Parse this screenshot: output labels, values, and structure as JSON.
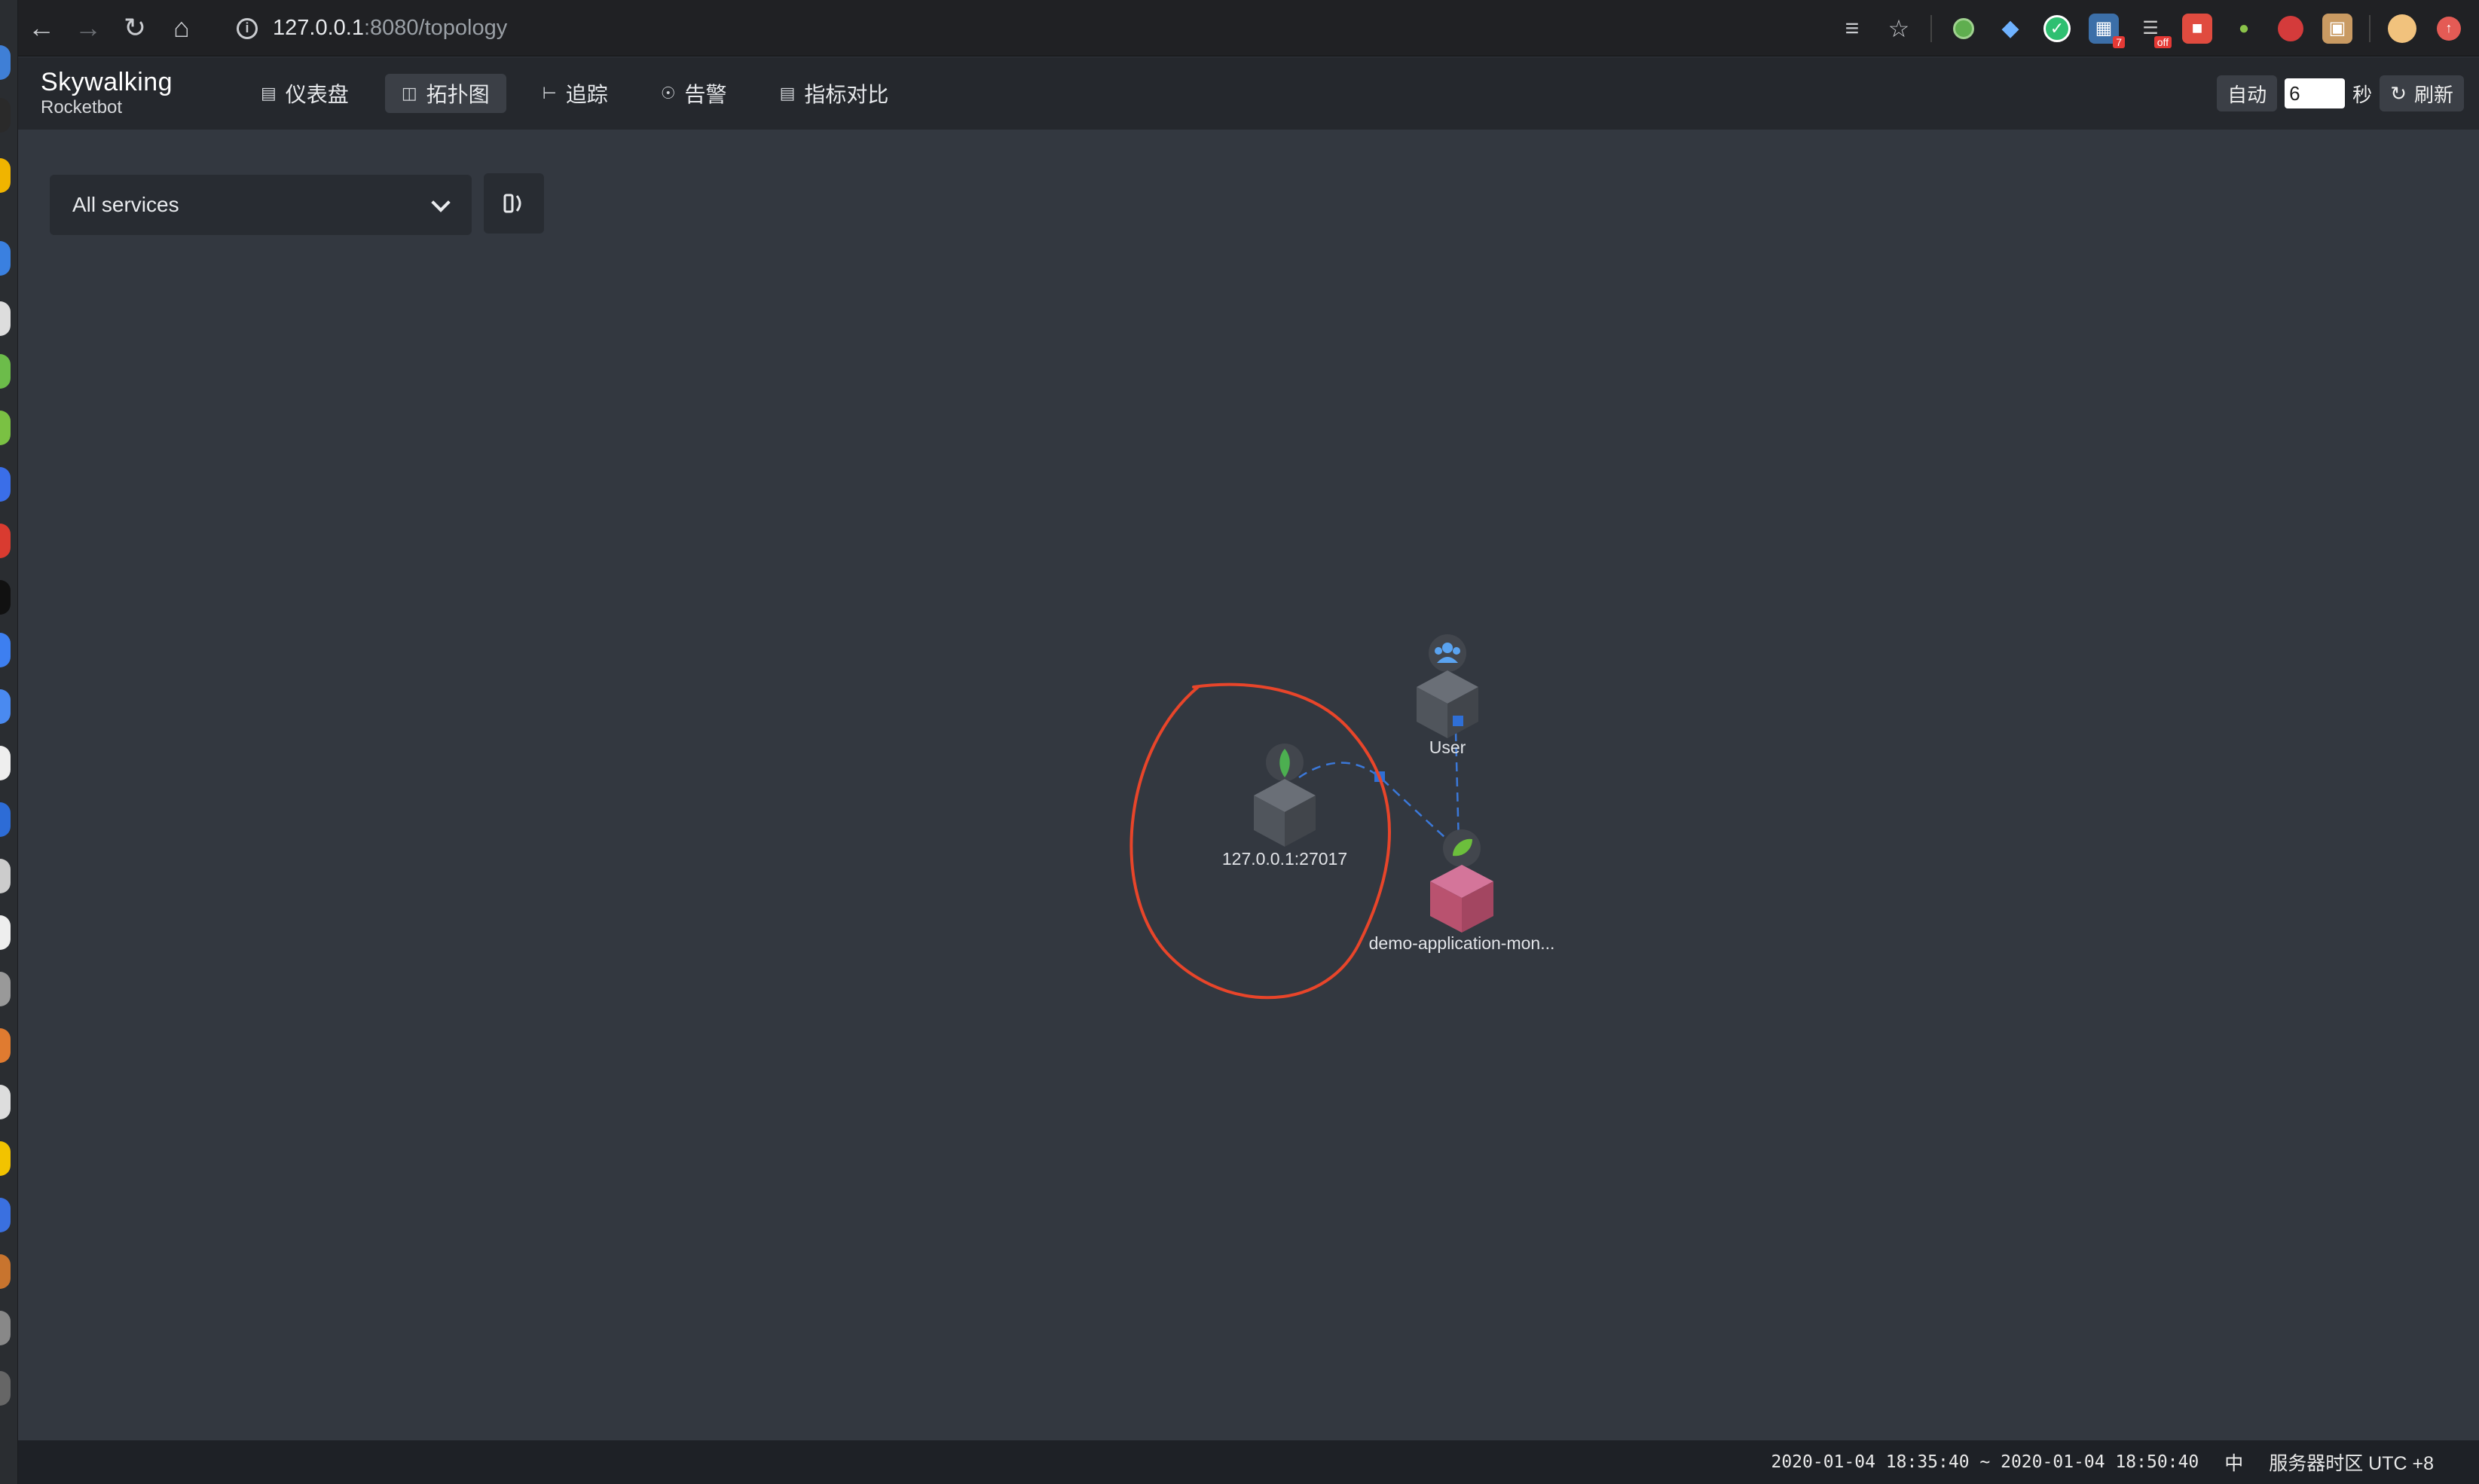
{
  "browser": {
    "url_host": "127.0.0.1",
    "url_path": ":8080/topology",
    "extension_badges": [
      "7",
      "off"
    ]
  },
  "app": {
    "logo_name": "Skywalking",
    "logo_sub": "Rocketbot"
  },
  "nav": {
    "items": [
      {
        "label": "仪表盘",
        "icon": "dashboard-icon"
      },
      {
        "label": "拓扑图",
        "icon": "topology-icon"
      },
      {
        "label": "追踪",
        "icon": "trace-icon"
      },
      {
        "label": "告警",
        "icon": "alarm-icon"
      },
      {
        "label": "指标对比",
        "icon": "comparison-icon"
      }
    ],
    "active_index": 1
  },
  "refresh": {
    "auto_label": "自动",
    "interval_value": "6",
    "unit_label": "秒",
    "refresh_label": "刷新"
  },
  "toolbar": {
    "service_selected": "All services"
  },
  "topology": {
    "nodes": [
      {
        "id": "mongo",
        "label": "127.0.0.1:27017",
        "kind": "database",
        "badge": "mongodb-leaf-icon"
      },
      {
        "id": "user",
        "label": "User",
        "kind": "user",
        "badge": "users-icon"
      },
      {
        "id": "app",
        "label": "demo-application-mon...",
        "kind": "service",
        "badge": "spring-leaf-icon"
      }
    ],
    "edges": [
      {
        "from": "app",
        "to": "mongo"
      },
      {
        "from": "user",
        "to": "app"
      }
    ],
    "annotation": "red-hand-drawn-circle"
  },
  "status": {
    "time_range": "2020-01-04 18:35:40 ~ 2020-01-04 18:50:40",
    "lang": "中",
    "timezone": "服务器时区 UTC +8"
  },
  "colors": {
    "background": "#333840",
    "header": "#25282d",
    "service_node": "#c0567a",
    "neutral_node": "#4d525a",
    "edge": "#3b78d8",
    "annotation": "#e8452a"
  }
}
